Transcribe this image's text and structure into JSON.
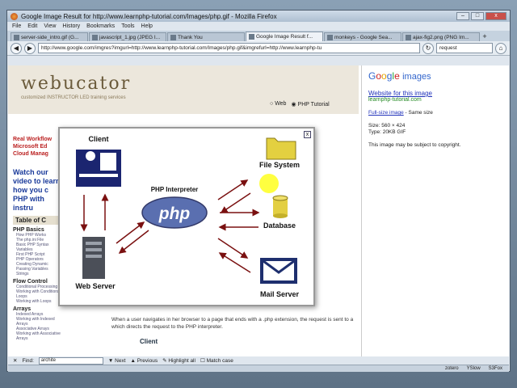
{
  "window": {
    "title": "Google Image Result for http://www.learnphp-tutorial.com/Images/php.gif - Mozilla Firefox",
    "controls": [
      "–",
      "□",
      "x"
    ]
  },
  "menu": [
    "File",
    "Edit",
    "View",
    "History",
    "Bookmarks",
    "Tools",
    "Help"
  ],
  "tabs": [
    {
      "label": "server-side_intro.gif (G..."
    },
    {
      "label": "javascript_1.jpg (JPEG I..."
    },
    {
      "label": "Thank You"
    },
    {
      "label": "Google Image Result f...",
      "active": true
    },
    {
      "label": "monkeys - Google Sea..."
    },
    {
      "label": "ajax-fig2.png (PNG Im..."
    }
  ],
  "nav": {
    "url": "http://www.google.com/imgres?imgurl=http://www.learnphp-tutorial.com/Images/php.gif&imgrefurl=http://www.learnphp-tu",
    "search_value": "request"
  },
  "page": {
    "logo": "webucator",
    "tagline": "customized INSTRUCTOR LED training services",
    "radio_web": "Web",
    "radio_php": "PHP Tutorial",
    "sidebar": {
      "links": [
        "Real Workflow",
        "Microsoft Ed",
        "Cloud Manag"
      ],
      "watch": "Watch our video to learn how you c PHP with instru",
      "toc": "Table of C",
      "sections": [
        {
          "title": "PHP Basics",
          "items": [
            "How PHP Works",
            "The php.ini File",
            "Basic PHP Syntax",
            "Variables",
            "First PHP Script",
            "PHP Operators",
            "Creating Dynamic",
            "Passing Variables",
            "Strings"
          ]
        },
        {
          "title": "Flow Control",
          "items": [
            "Conditional Processing",
            "Working with Conditions",
            "Loops",
            "Working with Loops"
          ]
        },
        {
          "title": "Arrays",
          "items": [
            "Indexed Arrays",
            "Working with Indexed Arrays",
            "Associative Arrays",
            "Working with Associative Arrays"
          ]
        }
      ]
    },
    "body_text": "When a user navigates in her browser to a page that ends with a .php extension, the request is sent to a which directs the request to the PHP interpreter.",
    "bottom_label": "Client"
  },
  "diagram": {
    "client": "Client",
    "interpreter_label": "PHP Interpreter",
    "php_logo": "php",
    "web_server": "Web Server",
    "file_system": "File System",
    "database": "Database",
    "mail_server": "Mail Server",
    "close": "x"
  },
  "google_pane": {
    "logo_letters": [
      "G",
      "o",
      "o",
      "g",
      "l",
      "e"
    ],
    "logo_images": "images",
    "website_link": "Website for this image",
    "source": "learnphp-tutorial.com",
    "full_size": "Full-size image",
    "same_size": " - Same size",
    "size": "Size:   560 × 424",
    "type": "Type:   20KB GIF",
    "copyright": "This image may be subject to copyright."
  },
  "findbar": {
    "label": "Find:",
    "value": "archite",
    "next": "Next",
    "previous": "Previous",
    "highlight": "Highlight all",
    "match_case": "Match case"
  },
  "statusbar": [
    "zotero",
    "YSlow",
    "S3Fox"
  ],
  "colors": {
    "arrow": "#7a1010",
    "php_blue": "#5a6fb0",
    "folder": "#e3d040",
    "mail": "#1e2f6e"
  }
}
